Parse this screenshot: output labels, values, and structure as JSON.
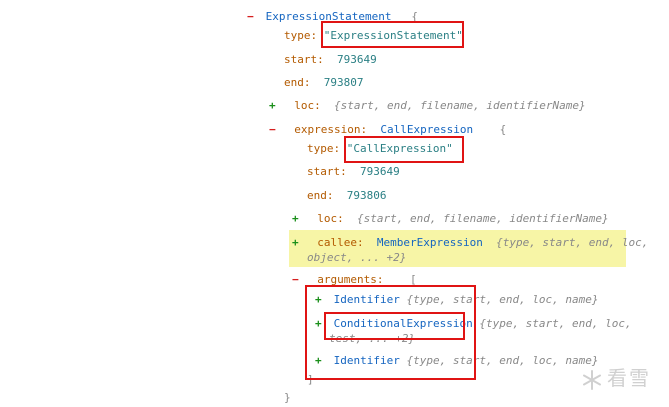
{
  "node": {
    "label": "ExpressionStatement",
    "brace_open": "{",
    "type_key": "type:",
    "type_value": "\"ExpressionStatement\"",
    "start_key": "start:",
    "start_value": "793649",
    "end_key": "end:",
    "end_value": "793807",
    "loc_key": "loc:",
    "loc_summary": "{start, end, filename, identifierName}",
    "expression_key": "expression:",
    "expression_type": "CallExpression",
    "expression_brace": "{",
    "brace_close": "}"
  },
  "call": {
    "type_key": "type:",
    "type_value": "\"CallExpression\"",
    "start_key": "start:",
    "start_value": "793649",
    "end_key": "end:",
    "end_value": "793806",
    "loc_key": "loc:",
    "loc_summary": "{start, end, filename, identifierName}",
    "callee_key": "callee:",
    "callee_type": "MemberExpression",
    "callee_summary_1": "{type, start, end, loc,",
    "callee_summary_2": "object, ... +2}",
    "arguments_key": "arguments:",
    "arguments_bracket": "[",
    "arguments_close": "]"
  },
  "arguments": [
    {
      "type": "Identifier",
      "summary": "{type, start, end, loc, name}"
    },
    {
      "type": "ConditionalExpression",
      "summary": "{type, start, end, loc,",
      "summary_2": "test, ... +2}"
    },
    {
      "type": "Identifier",
      "summary": "{type, start, end, loc, name}"
    }
  ],
  "toggles": {
    "minus": "−",
    "plus": "+"
  },
  "watermark": {
    "text": "看雪"
  },
  "colors": {
    "highlight": "#f7f5a6",
    "annotation_box": "#e01414"
  }
}
